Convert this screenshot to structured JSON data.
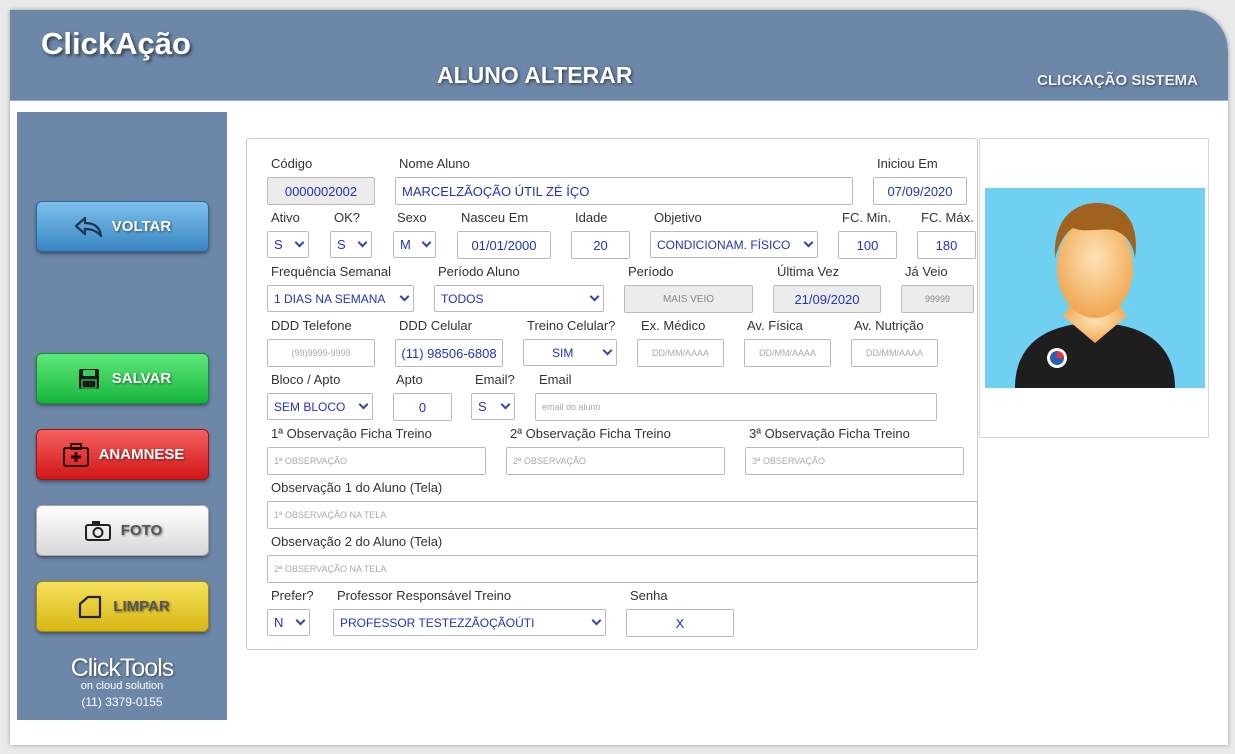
{
  "header": {
    "brand": "ClickAção",
    "title": "ALUNO ALTERAR",
    "system": "CLICKAÇÃO SISTEMA"
  },
  "sidebar": {
    "buttons": {
      "voltar": "VOLTAR",
      "salvar": "SALVAR",
      "anamnese": "ANAMNESE",
      "foto": "FOTO",
      "limpar": "LIMPAR"
    },
    "logo": {
      "name": "ClickTools",
      "tagline": "on cloud solution",
      "phone": "(11) 3379-0155"
    }
  },
  "form": {
    "labels": {
      "codigo": "Código",
      "nome": "Nome Aluno",
      "iniciou": "Iniciou Em",
      "ativo": "Ativo",
      "ok": "OK?",
      "sexo": "Sexo",
      "nasceu": "Nasceu Em",
      "idade": "Idade",
      "objetivo": "Objetivo",
      "fc_min": "FC. Min.",
      "fc_max": "FC. Máx.",
      "frequencia": "Frequência Semanal",
      "periodo_aluno": "Período Aluno",
      "periodo": "Período",
      "ultima_vez": "Última Vez",
      "ja_veio": "Já Veio",
      "ddd_tel": "DDD Telefone",
      "ddd_cel": "DDD Celular",
      "treino_cel": "Treino Celular?",
      "ex_medico": "Ex. Médico",
      "av_fisica": "Av. Física",
      "av_nutricao": "Av. Nutrição",
      "bloco": "Bloco / Apto",
      "apto": "Apto",
      "email_q": "Email?",
      "email": "Email",
      "obs1": "1ª Observação Ficha Treino",
      "obs2": "2ª Observação Ficha Treino",
      "obs3": "3ª Observação Ficha Treino",
      "obs_tela1": "Observação 1 do Aluno (Tela)",
      "obs_tela2": "Observação 2 do Aluno (Tela)",
      "prefer": "Prefer?",
      "professor": "Professor Responsável Treino",
      "senha": "Senha"
    },
    "values": {
      "codigo": "0000002002",
      "nome": "MARCELZÃOÇÃO ÚTIL ZÉ ÍÇO",
      "iniciou": "07/09/2020",
      "ativo": "S",
      "ok": "S",
      "sexo": "M",
      "nasceu": "01/01/2000",
      "idade": "20",
      "objetivo": "CONDICIONAM. FÍSICO",
      "fc_min": "100",
      "fc_max": "180",
      "frequencia": "1 DIAS NA SEMANA",
      "periodo_aluno": "TODOS",
      "periodo": "MAIS VEIO",
      "ultima_vez": "21/09/2020",
      "ja_veio": "99999",
      "ddd_cel": "(11) 98506-6808",
      "treino_cel": "SIM",
      "bloco": "SEM BLOCO",
      "apto": "0",
      "email_q": "S",
      "prefer": "N",
      "professor": "PROFESSOR TESTEZZÃOÇÃOÚTI",
      "senha": "X"
    },
    "placeholders": {
      "ddd_tel": "(99)9999-9999",
      "ex_medico": "DD/MM/AAAA",
      "av_fisica": "DD/MM/AAAA",
      "av_nutricao": "DD/MM/AAAA",
      "email": "email do aluno",
      "obs1": "1ª OBSERVAÇÃO",
      "obs2": "2ª OBSERVAÇÃO",
      "obs3": "3ª OBSERVAÇÃO",
      "obs_tela1": "1ª OBSERVAÇÃO NA TELA",
      "obs_tela2": "2ª OBSERVAÇÃO NA TELA"
    }
  },
  "colors": {
    "header": "#6d87a8",
    "field_text": "#2233bb",
    "photo_bg": "#6fd0f2"
  }
}
